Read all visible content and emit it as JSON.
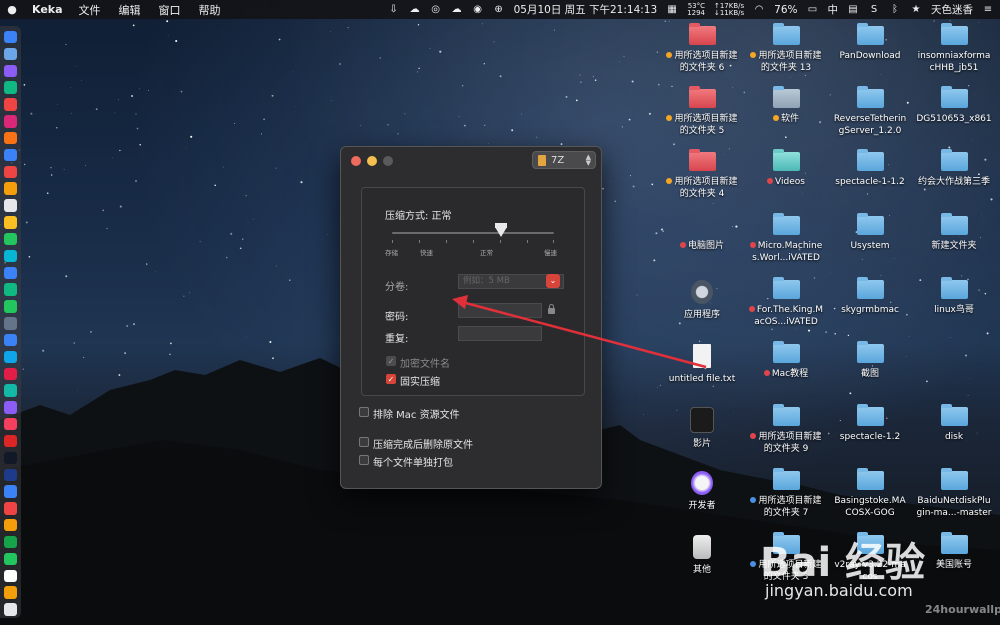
{
  "menubar": {
    "app_name": "Keka",
    "menus": [
      "文件",
      "编辑",
      "窗口",
      "帮助"
    ],
    "temp": "53°C",
    "rpm": "1294",
    "up_speed": "↑17KB/s",
    "down_speed": "↓11KB/s",
    "datetime": "05月10日 周五 下午21:14:13",
    "battery": "76%",
    "input_method": "中",
    "user": "天色迷香"
  },
  "window": {
    "format": "7Z",
    "compression_label": "压缩方式: 正常",
    "compression_level": 0.67,
    "levels": [
      "存储",
      "快速",
      "正常",
      "慢速"
    ],
    "split_label": "分卷:",
    "split_placeholder": "例如：5 MB",
    "password_label": "密码:",
    "repeat_label": "重复:",
    "encrypt_names": "加密文件名",
    "solid_compress": "固实压缩",
    "exclude_mac": "排除 Mac 资源文件",
    "delete_after": "压缩完成后删除原文件",
    "each_separately": "每个文件单独打包"
  },
  "desktop": {
    "col1": [
      "用所选项目新建的文件夹 6",
      "用所选项目新建的文件夹 5",
      "用所选项目新建的文件夹 4",
      "电脑图片",
      "应用程序",
      "untitled file.txt",
      "影片",
      "开发者",
      "其他"
    ],
    "col2": [
      "用所选项目新建的文件夹 13",
      "软件",
      "Videos",
      "Micro.Machines.Worl...iVATED",
      "For.The.King.MacOS...iVATED",
      "Mac教程",
      "用所选项目新建的文件夹 9",
      "用所选项目新建的文件夹 7",
      "用所选项目新建的文件夹 3"
    ],
    "col3": [
      "PanDownload",
      "ReverseTetheringServer_1.2.0",
      "spectacle-1-1.2",
      "Usystem",
      "skygrmbmac",
      "截图",
      "spectacle-1.2",
      "Basingstoke.MACOSX-GOG",
      "v2ray-v3.22-macos"
    ],
    "col4": [
      "insomniaxformacHHB_jb51",
      "DG510653_x861",
      "约会大作战第三季",
      "新建文件夹",
      "linux鸟哥",
      "",
      "disk",
      "BaiduNetdiskPlugin-ma...-master",
      "美国账号"
    ]
  },
  "watermark": {
    "brand": "Bai 经验",
    "url": "jingyan.baidu.com",
    "credit": "24hourwallpa"
  }
}
